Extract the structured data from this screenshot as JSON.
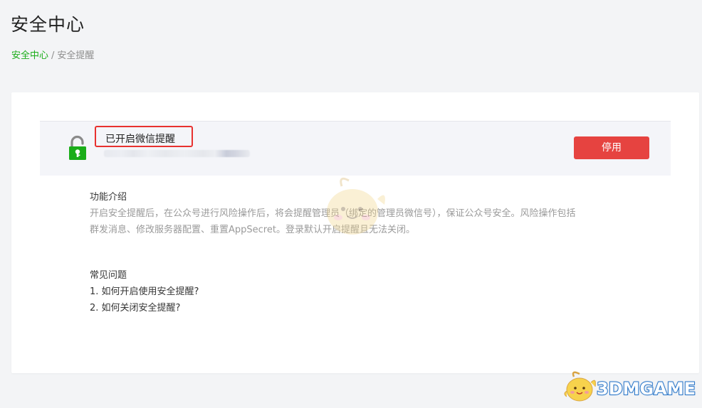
{
  "page": {
    "title": "安全中心"
  },
  "breadcrumb": {
    "parent": "安全中心",
    "separator": "/",
    "current": "安全提醒"
  },
  "status": {
    "title": "已开启微信提醒",
    "button_label": "停用",
    "lock_icon": "unlocked-padlock-icon",
    "colors": {
      "lock_green": "#1aad19",
      "button_red": "#e64340",
      "highlight_border": "#e8312f"
    }
  },
  "intro": {
    "title": "功能介绍",
    "text": "开启安全提醒后，在公众号进行风险操作后，将会提醒管理员（绑定的管理员微信号），保证公众号安全。风险操作包括\n群发消息、修改服务器配置、重置AppSecret。登录默认开启提醒且无法关闭。"
  },
  "faq": {
    "title": "常见问题",
    "items": [
      "1. 如何开启使用安全提醒?",
      "2. 如何关闭安全提醒?"
    ]
  },
  "watermark": {
    "text": "3DMGAME"
  }
}
